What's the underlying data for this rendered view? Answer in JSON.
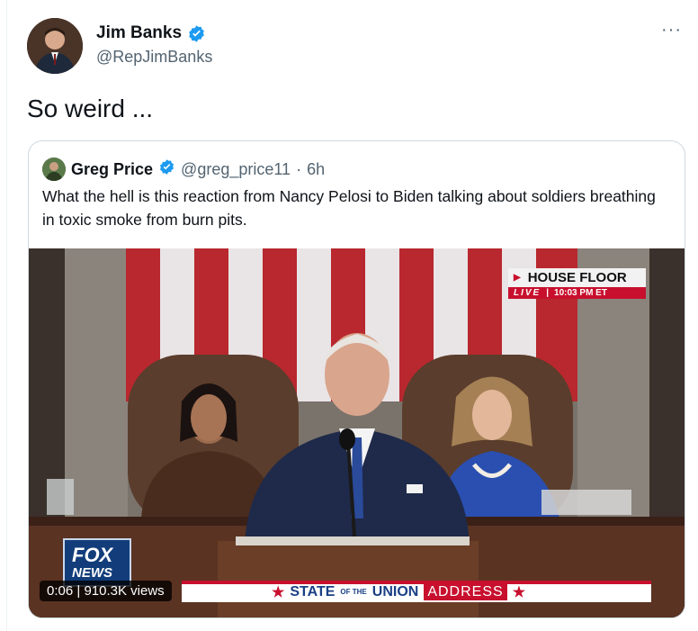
{
  "author": {
    "name": "Jim Banks",
    "handle": "@RepJimBanks",
    "verified_color": "#1d9bf0"
  },
  "more_label": "···",
  "tweet": {
    "text": "So weird ..."
  },
  "quote": {
    "name": "Greg Price",
    "handle": "@greg_price11",
    "separator": "·",
    "time": "6h",
    "text": "What the hell is this reaction from Nancy Pelosi to Biden talking about soldiers breathing in toxic smoke from burn pits."
  },
  "video": {
    "house_floor": "HOUSE FLOOR",
    "live": "LIVE",
    "live_sep": "|",
    "live_time": "10:03 PM ET",
    "fox_line1": "FOX",
    "fox_line2": "NEWS",
    "ticker_state": "STATE",
    "ticker_of_the": "OF THE",
    "ticker_union": "UNION",
    "ticker_address": "ADDRESS",
    "time": "0:06",
    "views": "910.3K views"
  },
  "colors": {
    "accent": "#1d9bf0",
    "fox_red": "#c8102e",
    "fox_blue": "#1a3f85"
  }
}
